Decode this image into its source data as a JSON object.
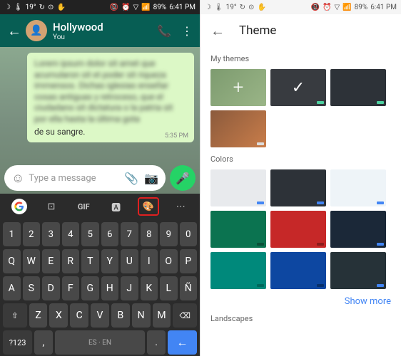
{
  "status": {
    "left_icons": [
      "☽",
      "🌡",
      "19°",
      "↻",
      "⊙",
      "✋"
    ],
    "right_icons": [
      "📵",
      "⏰",
      "▽",
      "📶"
    ],
    "battery": "89%",
    "time": "6:41 PM"
  },
  "wa": {
    "contact_name": "Hollywood",
    "contact_sub": "You",
    "bubble_blur": "Lorem ipsum dolor sit amet que acumularon sit et poder sit riqueza immensos. Dichas iglesias enseñar cosas antiguas y retroceso, que el ciudadano sit dictatura o la patria sit por ella hasta la última gota",
    "bubble_clear": "de su sangre.",
    "bubble_time": "5:35 PM",
    "input_placeholder": "Type a message"
  },
  "keyboard": {
    "top_items": [
      "G",
      "sticker",
      "GIF",
      "translate",
      "palette",
      "more"
    ],
    "gif_label": "GIF",
    "numbers": [
      "1",
      "2",
      "3",
      "4",
      "5",
      "6",
      "7",
      "8",
      "9",
      "0"
    ],
    "row1": [
      "Q",
      "W",
      "E",
      "R",
      "T",
      "Y",
      "U",
      "I",
      "O",
      "P"
    ],
    "row2": [
      "A",
      "S",
      "D",
      "F",
      "G",
      "H",
      "J",
      "K",
      "L",
      "Ñ"
    ],
    "row3_shift": "⇧",
    "row3": [
      "Z",
      "X",
      "C",
      "V",
      "B",
      "N",
      "M"
    ],
    "row3_del": "⌫",
    "bottom_sym": "?123",
    "bottom_comma": ",",
    "bottom_lang": "ES · EN",
    "bottom_period": ".",
    "bottom_enter": "←"
  },
  "theme": {
    "title": "Theme",
    "section_mythemes": "My themes",
    "section_colors": "Colors",
    "section_landscapes": "Landscapes",
    "show_more": "Show more",
    "mythemes": [
      {
        "bg": "linear-gradient(135deg,#7d9b6f,#9ab587)",
        "plus": true
      },
      {
        "bg": "#383b40",
        "check": true,
        "dot": "#4dd0a0"
      },
      {
        "bg": "#2d3238",
        "dot": "#4dd0a0"
      },
      {
        "bg": "linear-gradient(135deg,#8b5a3c,#c97d4a)",
        "image": true,
        "dot": "#ddd"
      }
    ],
    "colors": [
      {
        "bg": "#e8eaed",
        "dot": "#4285F4"
      },
      {
        "bg": "#2d3238",
        "dot": "#4285F4"
      },
      {
        "bg": "#eef4f8",
        "dot": "#4285F4"
      },
      {
        "bg": "#0b7350",
        "dot": "#0a5038"
      },
      {
        "bg": "#c62828",
        "dot": "#8b1c1c"
      },
      {
        "bg": "#1b2838",
        "dot": "#4285F4"
      },
      {
        "bg": "#00897b",
        "dot": "#00695c"
      },
      {
        "bg": "#0d47a1",
        "dot": "#08306b"
      },
      {
        "bg": "#263238",
        "dot": "#4285F4"
      }
    ]
  }
}
